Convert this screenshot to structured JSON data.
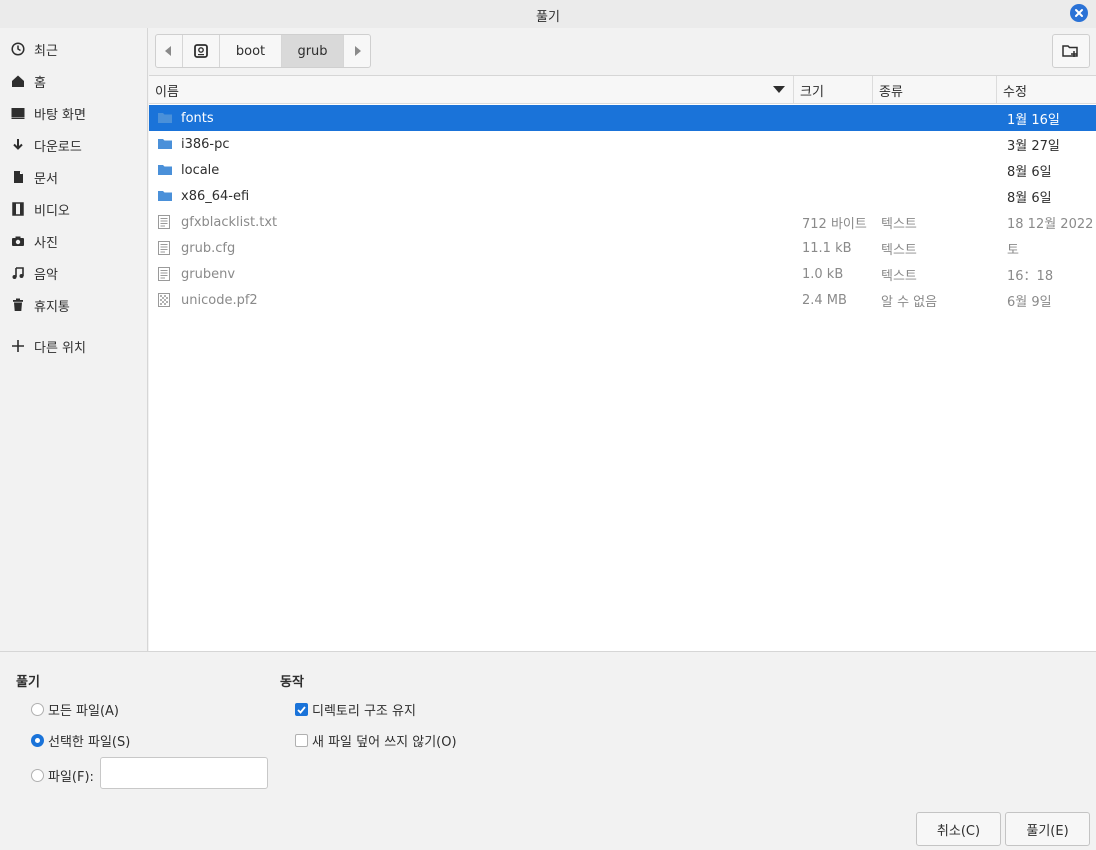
{
  "window": {
    "title": "풀기"
  },
  "sidebar": {
    "items": [
      {
        "label": "최근",
        "icon": "clock-icon"
      },
      {
        "label": "홈",
        "icon": "home-icon"
      },
      {
        "label": "바탕 화면",
        "icon": "desktop-icon"
      },
      {
        "label": "다운로드",
        "icon": "download-icon"
      },
      {
        "label": "문서",
        "icon": "document-icon"
      },
      {
        "label": "비디오",
        "icon": "video-icon"
      },
      {
        "label": "사진",
        "icon": "camera-icon"
      },
      {
        "label": "음악",
        "icon": "music-icon"
      },
      {
        "label": "휴지통",
        "icon": "trash-icon"
      }
    ],
    "other_locations": {
      "label": "다른 위치",
      "icon": "plus-icon"
    }
  },
  "pathbar": {
    "segments": [
      "boot",
      "grub"
    ],
    "active": "grub"
  },
  "columns": {
    "name": "이름",
    "size": "크기",
    "type": "종류",
    "modified": "수정"
  },
  "files": [
    {
      "name": "fonts",
      "kind": "folder",
      "size": "",
      "type": "",
      "modified": "1월 16일",
      "selected": true
    },
    {
      "name": "i386-pc",
      "kind": "folder",
      "size": "",
      "type": "",
      "modified": "3월 27일"
    },
    {
      "name": "locale",
      "kind": "folder",
      "size": "",
      "type": "",
      "modified": "8월 6일"
    },
    {
      "name": "x86_64-efi",
      "kind": "folder",
      "size": "",
      "type": "",
      "modified": "8월 6일"
    },
    {
      "name": "gfxblacklist.txt",
      "kind": "text",
      "size": "712 바이트",
      "type": "텍스트",
      "modified": "18 12월 2022"
    },
    {
      "name": "grub.cfg",
      "kind": "text",
      "size": "11.1 kB",
      "type": "텍스트",
      "modified": "토"
    },
    {
      "name": "grubenv",
      "kind": "text",
      "size": "1.0 kB",
      "type": "텍스트",
      "modified": "16：18"
    },
    {
      "name": "unicode.pf2",
      "kind": "binary",
      "size": "2.4 MB",
      "type": "알 수 없음",
      "modified": "6월 9일"
    }
  ],
  "extract": {
    "title": "풀기",
    "all_files": "모든 파일(A)",
    "selected_files": "선택한 파일(S)",
    "files": "파일(F):",
    "files_value": "",
    "selected_option": "selected_files"
  },
  "action": {
    "title": "동작",
    "keep_dirs": "디렉토리 구조 유지",
    "keep_dirs_checked": true,
    "no_overwrite": "새 파일 덮어 쓰지 않기(O)",
    "no_overwrite_checked": false
  },
  "buttons": {
    "cancel": "취소(C)",
    "extract": "풀기(E)"
  },
  "colors": {
    "accent": "#1a73d9",
    "folder": "#4a90d9",
    "close": "#2a72d6"
  }
}
